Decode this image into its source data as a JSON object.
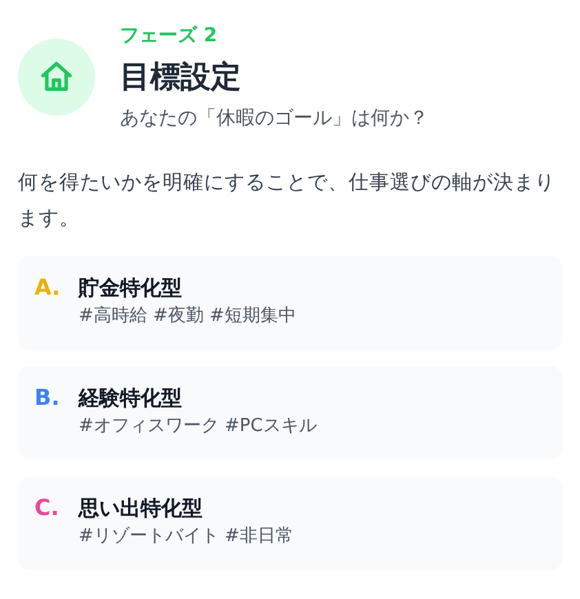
{
  "header": {
    "phase": "フェーズ 2",
    "title": "目標設定",
    "subtitle": "あなたの「休暇のゴール」は何か？"
  },
  "description": "何を得たいかを明確にすることで、仕事選びの軸が決まります。",
  "options": [
    {
      "letter": "A.",
      "color": "#eab308",
      "title": "貯金特化型",
      "tags": "#高時給 #夜勤 #短期集中"
    },
    {
      "letter": "B.",
      "color": "#3b82f6",
      "title": "経験特化型",
      "tags": "#オフィスワーク #PCスキル"
    },
    {
      "letter": "C.",
      "color": "#ec4899",
      "title": "思い出特化型",
      "tags": "#リゾートバイト #非日常"
    }
  ]
}
